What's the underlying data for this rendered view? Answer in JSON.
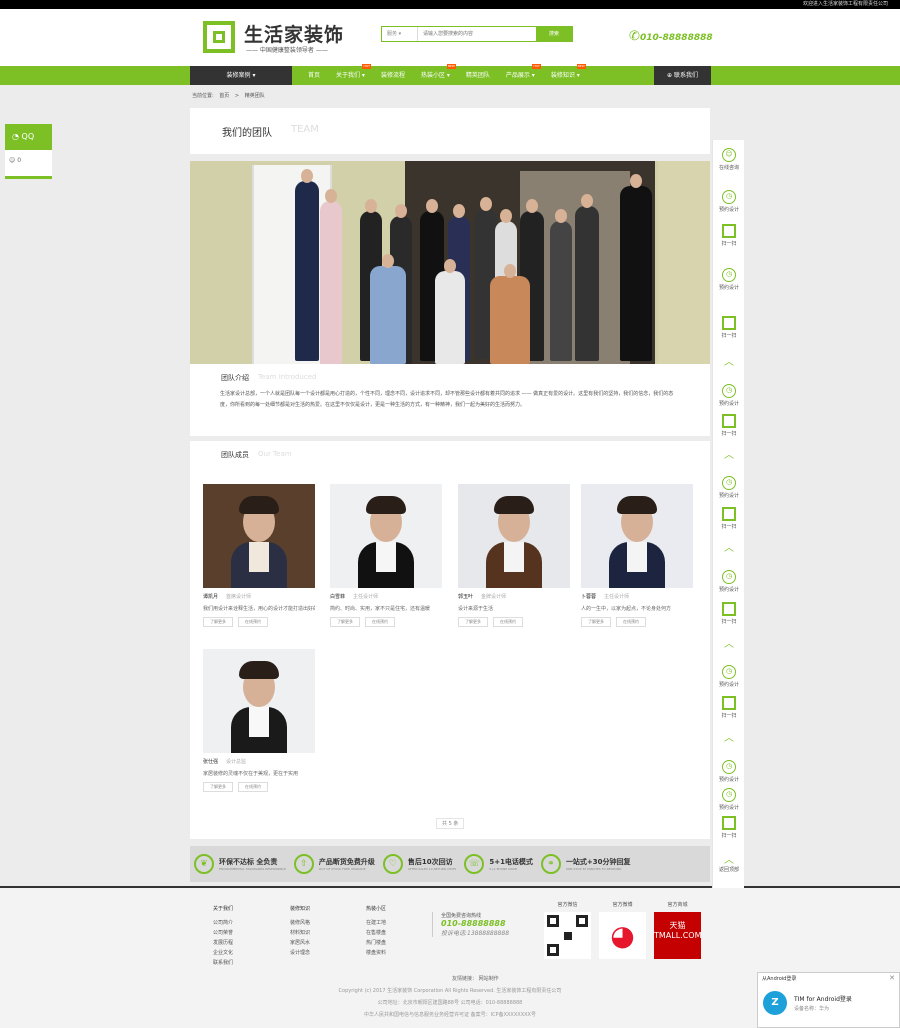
{
  "top_strip": {
    "text": "欢迎进入生活家装饰工程有限责任公司"
  },
  "header": {
    "logo_title": "生活家装饰",
    "logo_subtitle": "—— 中国健康整装领导者 ——",
    "search": {
      "select": "服务",
      "placeholder": "请输入您要搜索的内容",
      "button": "搜索"
    },
    "phone": "010-88888888"
  },
  "nav": {
    "case_label": "装修案例 ▾",
    "items": [
      {
        "label": "首页",
        "hot": ""
      },
      {
        "label": "关于我们 ▾",
        "hot": "HOT"
      },
      {
        "label": "装修流程",
        "hot": ""
      },
      {
        "label": "热装小区 ▾",
        "hot": "NEW"
      },
      {
        "label": "精英团队",
        "hot": ""
      },
      {
        "label": "产品展示 ▾",
        "hot": "HOT"
      },
      {
        "label": "装修知识 ▾",
        "hot": "NEW"
      }
    ],
    "contact_label": "联系我们"
  },
  "breadcrumb": {
    "label": "当前位置:",
    "home": "首页",
    "sep": ">",
    "current": "精英团队"
  },
  "qq_widget": {
    "title": "QQ",
    "count": "0"
  },
  "team_header": {
    "title": "我们的团队",
    "title_en": "TEAM"
  },
  "intro": {
    "title": "团队介绍",
    "title_en": "Team Introduced",
    "text": "生活家设计总部，一个人就是团队每一个设计都是用心打造的，个性不同，理念不同，设计追求不同，却不管那些设计都有着共同的追求 —— 做真正有爱的设计。这里有我们的坚持，我们的信念，我们的态度，你所看到的每一处细节都是对生活的热爱。在这里不仅仅是设计，更是一种生活的方式，有一种精神，我们一起为美好的生活而努力。"
  },
  "members": {
    "title": "团队成员",
    "title_en": "Our Team",
    "list": [
      {
        "name": "谭凯月",
        "role": "首席设计师",
        "desc": "我们用设计来诠释生活，用心的设计才能打造出好的作品",
        "btn1": "了解更多",
        "btn2": "在线预约"
      },
      {
        "name": "白雪菲",
        "role": "主任设计师",
        "desc": "简约、时尚、实用，家不只是住宅，还有温暖",
        "btn1": "了解更多",
        "btn2": "在线预约"
      },
      {
        "name": "郭玉叶",
        "role": "金牌设计师",
        "desc": "设计来源于生活",
        "btn1": "了解更多",
        "btn2": "在线预约"
      },
      {
        "name": "卜蓉蓉",
        "role": "主任设计师",
        "desc": "人的一生中，以家为起点，不论身处何方",
        "btn1": "了解更多",
        "btn2": "在线预约"
      },
      {
        "name": "张仕强",
        "role": "设计总监",
        "desc": "家居装修的灵魂不仅在于美观，更在于实用",
        "btn1": "了解更多",
        "btn2": "在线预约"
      }
    ],
    "pager": "共 5 条"
  },
  "features": [
    {
      "title": "环保不达标 全负责",
      "sub": "ENVIRONMENTAL STANDARDS RESPONSIBLE",
      "icon": "leaf-icon"
    },
    {
      "title": "产品断货免费升级",
      "sub": "OUT OF STOCK FREE UPGRADE",
      "icon": "upgrade-arrow-icon"
    },
    {
      "title": "售后10次回访",
      "sub": "AFTER-SALES 10 RETURN VISITS",
      "icon": "heart-icon"
    },
    {
      "title": "5+1电话模式",
      "sub": "5+1 PHONE MODE",
      "icon": "phone-mode-icon"
    },
    {
      "title": "一站式+30分钟回复",
      "sub": "ONE-STOP 30 MINUTES TO RESPOND",
      "icon": "link-icon"
    }
  ],
  "footer": {
    "cols": [
      {
        "title": "关于我们",
        "items": [
          "公司简介",
          "公司荣誉",
          "发展历程",
          "企业文化",
          "联系我们"
        ]
      },
      {
        "title": "装修知识",
        "items": [
          "装修风格",
          "材料知识",
          "家居风水",
          "设计理念"
        ]
      },
      {
        "title": "热装小区",
        "items": [
          "在建工地",
          "在售楼盘",
          "热门楼盘",
          "楼盘资料"
        ]
      }
    ],
    "phone_block": {
      "line1": "全国免费咨询热线",
      "phone": "010-88888888",
      "complaint": "投诉电话:13888888888"
    },
    "social": [
      {
        "label": "官方微信"
      },
      {
        "label": "官方微博"
      },
      {
        "label": "官方商城",
        "tmall": "天猫 TMALL.COM"
      }
    ],
    "links": "友情链接：  网站制作",
    "copy1": "Copyright (c) 2017 生活家装饰 Corporation All Rights Reserved. 生活家装饰工程有限责任公司",
    "copy2": "公司地址：北京市朝阳区建国路88号 公司电话：010-88888888",
    "copy3": "中华人民共和国电信与信息服务业务经营许可证 备案号：ICP备XXXXXXXX号"
  },
  "right_toolbar": {
    "items": [
      {
        "label": "在线咨询",
        "kind": "chat"
      },
      {
        "label": "预约设计",
        "kind": "clock"
      },
      {
        "label": "扫一扫",
        "kind": "qr"
      },
      {
        "label": "预约设计",
        "kind": "clock"
      },
      {
        "label": "扫一扫",
        "kind": "qr"
      },
      {
        "label": "",
        "kind": "up"
      },
      {
        "label": "预约设计",
        "kind": "clock"
      },
      {
        "label": "扫一扫",
        "kind": "qr"
      },
      {
        "label": "",
        "kind": "up"
      },
      {
        "label": "预约设计",
        "kind": "clock"
      },
      {
        "label": "扫一扫",
        "kind": "qr"
      },
      {
        "label": "",
        "kind": "up"
      },
      {
        "label": "预约设计",
        "kind": "clock"
      },
      {
        "label": "扫一扫",
        "kind": "qr"
      },
      {
        "label": "",
        "kind": "up"
      },
      {
        "label": "预约设计",
        "kind": "clock"
      },
      {
        "label": "扫一扫",
        "kind": "qr"
      },
      {
        "label": "",
        "kind": "up"
      },
      {
        "label": "预约设计",
        "kind": "clock"
      },
      {
        "label": "预约设计",
        "kind": "clock"
      },
      {
        "label": "扫一扫",
        "kind": "qr"
      },
      {
        "label": "返回顶部",
        "kind": "up"
      }
    ]
  },
  "notification": {
    "title": "从Android登录",
    "line1": "TIM for Android登录",
    "line2": "设备名称：华为"
  },
  "colors": {
    "accent": "#7cc026",
    "dark": "#333333"
  }
}
